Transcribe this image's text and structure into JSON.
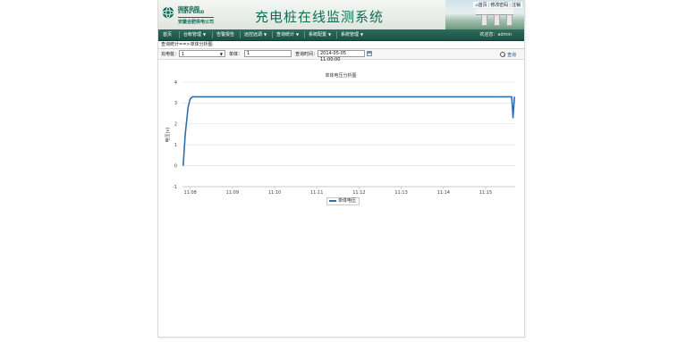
{
  "header": {
    "logo_cn": "国家电网",
    "logo_en": "STATE GRID",
    "logo_sub": "安徽合肥供电公司",
    "title": "充电桩在线监测系统",
    "links": [
      "首页",
      "修改密码",
      "注销"
    ]
  },
  "nav": {
    "items": [
      {
        "label": "首页",
        "dropdown": false
      },
      {
        "label": "台帐管理",
        "dropdown": true
      },
      {
        "label": "告警报告",
        "dropdown": false
      },
      {
        "label": "远控远调",
        "dropdown": true
      },
      {
        "label": "查询统计",
        "dropdown": true
      },
      {
        "label": "系统配置",
        "dropdown": true
      },
      {
        "label": "系统管理",
        "dropdown": true
      }
    ],
    "welcome": "欢迎您：admin"
  },
  "breadcrumb": "查询统计==>单体分析图",
  "filter": {
    "charger_label": "充电桩：",
    "charger_value": "1",
    "cell_label": "单体：",
    "cell_value": "1",
    "time_label": "查询时间：",
    "time_value": "2014-05-05 11:00:00",
    "query_label": "查询"
  },
  "chart_data": {
    "type": "line",
    "title": "单体电压分析图",
    "ylabel": "电压(v)",
    "xlabel": "",
    "ylim": [
      -1,
      4
    ],
    "yticks": [
      "-1",
      "0",
      "1",
      "2",
      "3",
      "4"
    ],
    "xticks": [
      "11:08",
      "11:09",
      "11:10",
      "11:11",
      "11:12",
      "11:13",
      "11:14",
      "11:15"
    ],
    "xlim": [
      "11:07:49",
      "11:15:42"
    ],
    "grid": true,
    "legend": "bottom-center",
    "series": [
      {
        "name": "单体电压",
        "color": "#2f6fae",
        "x": [
          "11:07:50",
          "11:07:53",
          "11:07:57",
          "11:08:00",
          "11:08:03",
          "11:15:20",
          "11:15:37",
          "11:15:38",
          "11:15:39",
          "11:15:40",
          "11:15:41"
        ],
        "y": [
          0,
          1.5,
          2.8,
          3.2,
          3.3,
          3.3,
          3.3,
          2.8,
          2.3,
          2.8,
          3.3
        ]
      }
    ]
  }
}
